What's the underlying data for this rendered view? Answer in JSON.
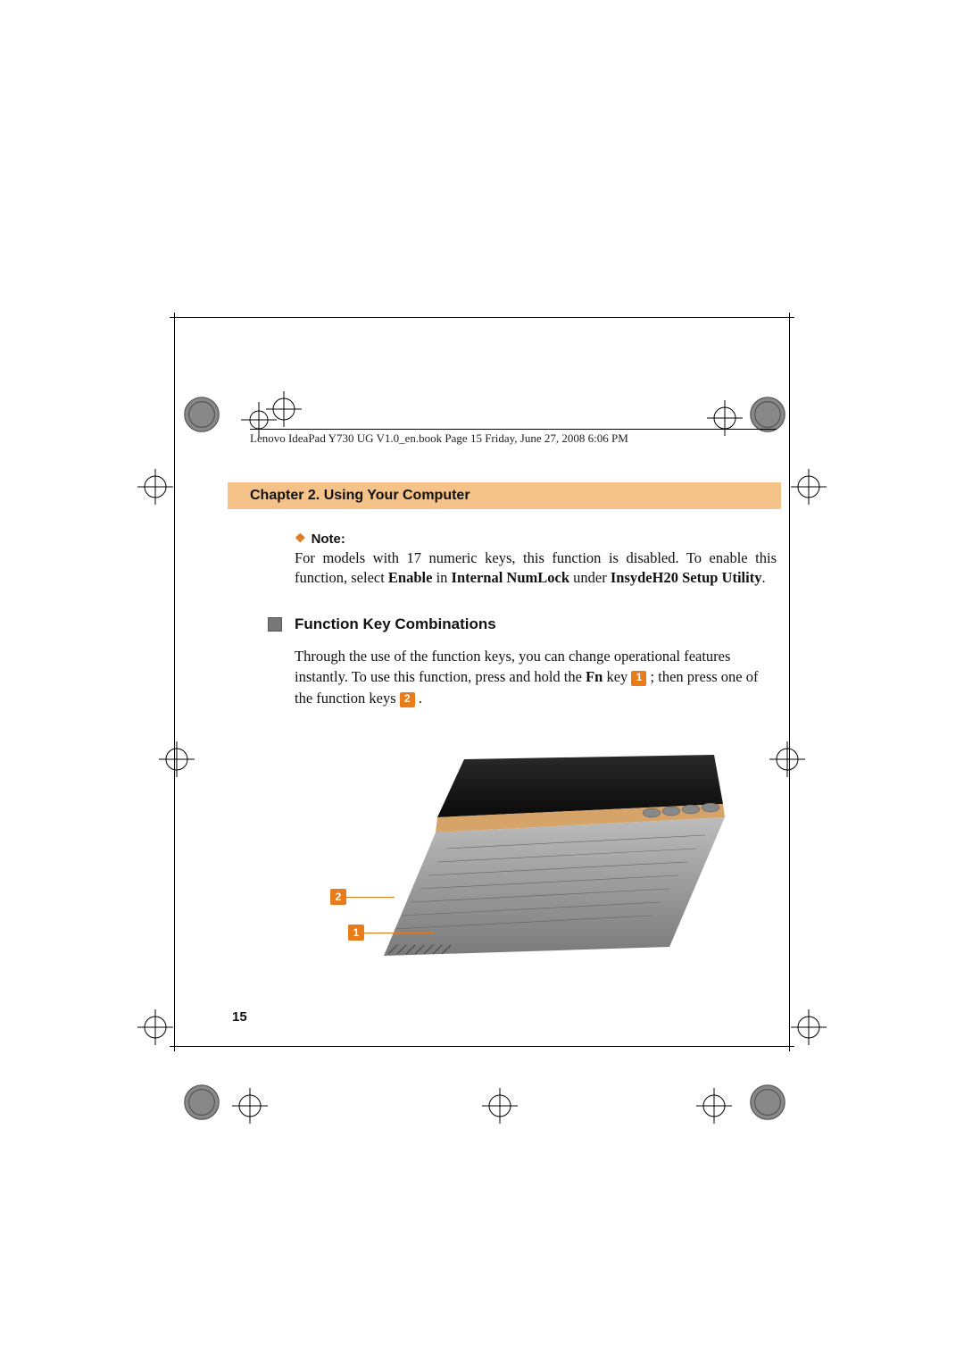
{
  "header_text": "Lenovo IdeaPad Y730 UG V1.0_en.book  Page 15  Friday, June 27, 2008  6:06 PM",
  "chapter_title": "Chapter 2. Using Your Computer",
  "note": {
    "label": "Note:",
    "body_pre": "For models with 17 numeric keys, this function is disabled. To enable this function, select ",
    "bold1": "Enable",
    "mid1": " in ",
    "bold2": "Internal NumLock",
    "mid2": " under ",
    "bold3": "InsydeH20 Setup Utility",
    "post": "."
  },
  "section": {
    "title": "Function Key Combinations",
    "p1": "Through the use of the function keys, you can change operational features instantly. To use this function, press and hold the ",
    "fn": "Fn",
    "p1b": " key ",
    "c1": "1",
    "p1c": " ; then press one of the function keys ",
    "c2": "2",
    "p1d": " ."
  },
  "figure_callouts": {
    "c1": "1",
    "c2": "2"
  },
  "page_number": "15"
}
